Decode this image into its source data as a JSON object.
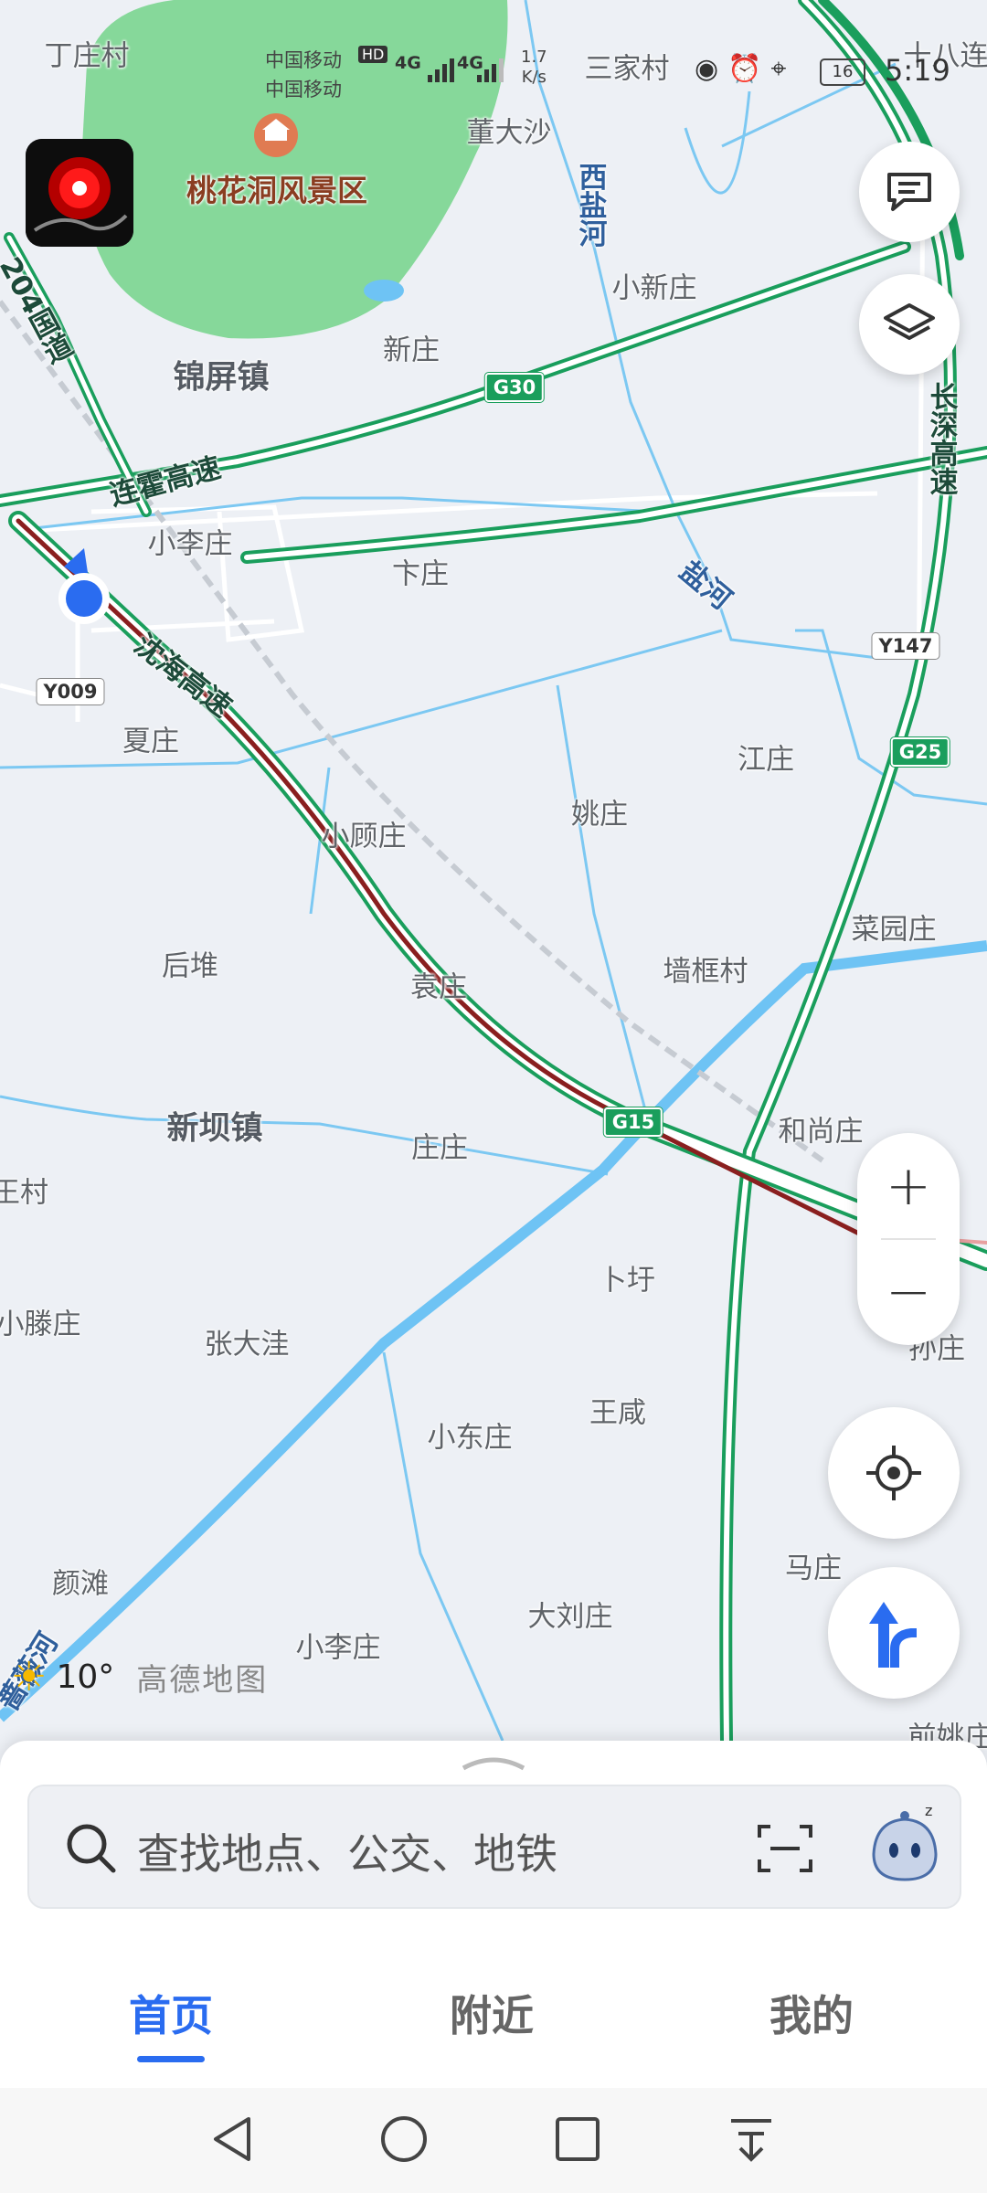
{
  "status_bar": {
    "carrier1": "中国移动",
    "carrier1_badge": "HD",
    "carrier2": "中国移动",
    "network": "4G",
    "speed_value": "1.7",
    "speed_unit": "K/s",
    "battery": "16",
    "time": "5:19"
  },
  "map": {
    "places": [
      {
        "text": "丁庄村",
        "kind": "village"
      },
      {
        "text": "三家村",
        "kind": "village"
      },
      {
        "text": "十八连",
        "kind": "village"
      },
      {
        "text": "董大沙",
        "kind": "village"
      },
      {
        "text": "桃花洞风景区",
        "kind": "scenic"
      },
      {
        "text": "小新庄",
        "kind": "village"
      },
      {
        "text": "新庄",
        "kind": "village"
      },
      {
        "text": "锦屏镇",
        "kind": "town"
      },
      {
        "text": "小李庄",
        "kind": "village"
      },
      {
        "text": "卞庄",
        "kind": "village"
      },
      {
        "text": "夏庄",
        "kind": "village"
      },
      {
        "text": "江庄",
        "kind": "village"
      },
      {
        "text": "姚庄",
        "kind": "village"
      },
      {
        "text": "小顾庄",
        "kind": "village"
      },
      {
        "text": "菜园庄",
        "kind": "village"
      },
      {
        "text": "后堆",
        "kind": "village"
      },
      {
        "text": "墙框村",
        "kind": "village"
      },
      {
        "text": "袁庄",
        "kind": "village"
      },
      {
        "text": "新坝镇",
        "kind": "town"
      },
      {
        "text": "庄庄",
        "kind": "village"
      },
      {
        "text": "和尚庄",
        "kind": "village"
      },
      {
        "text": "王村",
        "kind": "village"
      },
      {
        "text": "卜圩",
        "kind": "village"
      },
      {
        "text": "小滕庄",
        "kind": "village"
      },
      {
        "text": "张大洼",
        "kind": "village"
      },
      {
        "text": "孙庄",
        "kind": "village"
      },
      {
        "text": "王咸",
        "kind": "village"
      },
      {
        "text": "小东庄",
        "kind": "village"
      },
      {
        "text": "马庄",
        "kind": "village"
      },
      {
        "text": "颜滩",
        "kind": "village"
      },
      {
        "text": "大刘庄",
        "kind": "village"
      },
      {
        "text": "小李庄",
        "kind": "village"
      },
      {
        "text": "前姚庄",
        "kind": "village"
      }
    ],
    "water_labels": [
      "西盐河",
      "盐河",
      "蔷薇河"
    ],
    "road_labels": [
      "连霍高速",
      "沈海高速",
      "长深高速",
      "204国道"
    ],
    "shields": [
      {
        "code": "G30",
        "style": "highway"
      },
      {
        "code": "G25",
        "style": "highway"
      },
      {
        "code": "G15",
        "style": "highway"
      },
      {
        "code": "Y147",
        "style": "local"
      },
      {
        "code": "Y009",
        "style": "local"
      }
    ]
  },
  "controls": {
    "feedback_icon": "message-icon",
    "layers_icon": "layers-icon",
    "zoom_in": "+",
    "zoom_out": "−",
    "locate_icon": "locate-icon",
    "route_icon": "route-icon"
  },
  "weather": {
    "temp": "10°",
    "icon": "sun-icon",
    "brand": "高德地图"
  },
  "search": {
    "placeholder": "查找地点、公交、地铁"
  },
  "tabs": [
    {
      "label": "首页",
      "active": true
    },
    {
      "label": "附近",
      "active": false
    },
    {
      "label": "我的",
      "active": false
    }
  ],
  "colors": {
    "highway": "#1a9e5c",
    "route": "#8a1f1f",
    "water": "#6ec3f4",
    "park": "#86d89a",
    "accent": "#2a6cf0"
  }
}
